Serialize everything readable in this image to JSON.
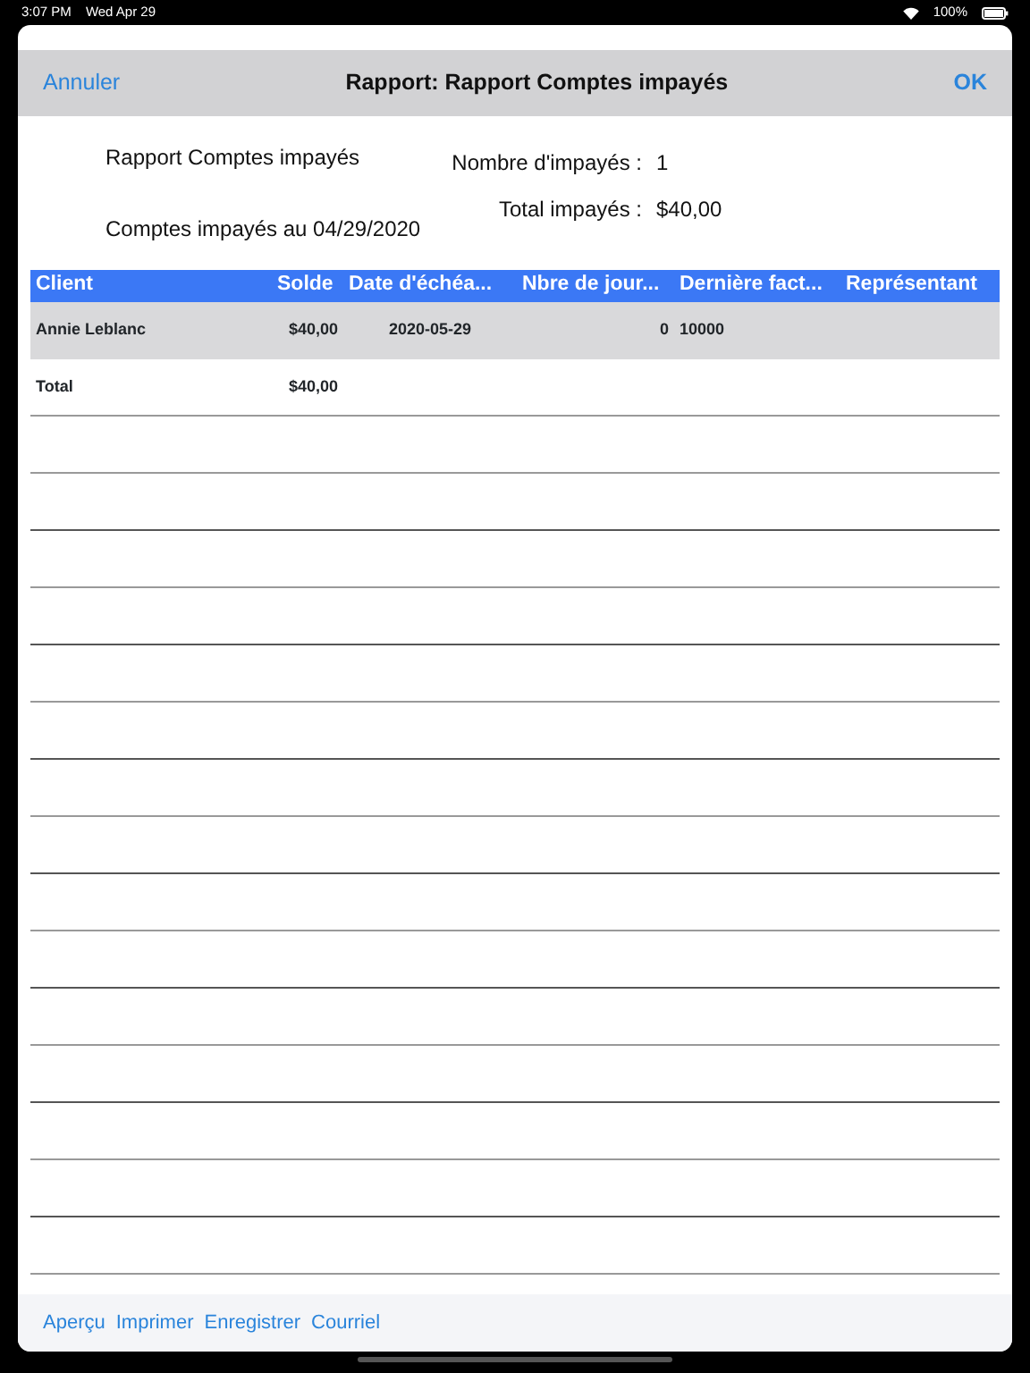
{
  "status_bar": {
    "time": "3:07 PM",
    "date": "Wed Apr 29",
    "battery": "100%"
  },
  "nav": {
    "cancel": "Annuler",
    "title": "Rapport: Rapport Comptes impayés",
    "ok": "OK"
  },
  "report": {
    "name": "Rapport Comptes impayés",
    "subtitle": "Comptes impayés au 04/29/2020",
    "summary": [
      {
        "label": "Nombre d'impayés :",
        "value": "1"
      },
      {
        "label": "Total impayés :",
        "value": "$40,00"
      }
    ]
  },
  "table": {
    "columns": [
      "Client",
      "Solde",
      "Date d'échéa...",
      "Nbre de jour...",
      "Dernière fact...",
      "Représentant"
    ],
    "rows": [
      [
        "Annie Leblanc",
        "$40,00",
        "2020-05-29",
        "0",
        "10000",
        ""
      ]
    ],
    "total": [
      "Total",
      "$40,00"
    ]
  },
  "toolbar": [
    "Aperçu",
    "Imprimer",
    "Enregistrer",
    "Courriel"
  ]
}
